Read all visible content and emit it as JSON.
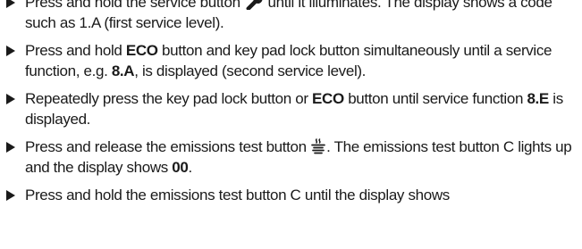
{
  "steps": [
    {
      "parts": [
        {
          "text": "Press and hold the service button "
        },
        {
          "icon": "wrench-icon"
        },
        {
          "text": " until it illuminates. The display shows a code such as 1.A (first service level)."
        }
      ]
    },
    {
      "parts": [
        {
          "text": "Press and hold "
        },
        {
          "text": "ECO",
          "bold": true
        },
        {
          "text": " button and key pad lock button simultaneously until a service function, e.g. "
        },
        {
          "text": "8.A",
          "bold": true
        },
        {
          "text": ", is displayed (second service level)."
        }
      ]
    },
    {
      "parts": [
        {
          "text": "Repeatedly press the key pad lock button or "
        },
        {
          "text": "ECO",
          "bold": true
        },
        {
          "text": " button until service function "
        },
        {
          "text": "8.E",
          "bold": true
        },
        {
          "text": " is displayed."
        }
      ]
    },
    {
      "parts": [
        {
          "text": "Press and release the emissions test button "
        },
        {
          "icon": "emissions-test-icon"
        },
        {
          "text": ". The emissions test button C lights up and the display shows "
        },
        {
          "text": "00",
          "bold": true
        },
        {
          "text": "."
        }
      ]
    },
    {
      "parts": [
        {
          "text": "Press and hold the emissions test button C until the display shows"
        }
      ]
    }
  ],
  "colors": {
    "text": "#1a1a1a",
    "bullet": "#1a1a1a"
  }
}
